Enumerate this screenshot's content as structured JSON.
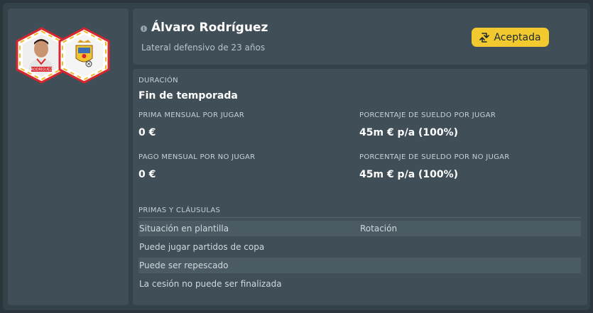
{
  "player": {
    "name": "Álvaro Rodríguez",
    "description": "Lateral defensivo de 23 años",
    "shirt_name": "RODRÍGUEZ"
  },
  "status": {
    "label": "Aceptada",
    "icon": "loan-arrows-icon"
  },
  "duration": {
    "label": "DURACIÓN",
    "value": "Fin de temporada"
  },
  "terms": {
    "monthly_play_label": "PRIMA MENSUAL POR JUGAR",
    "monthly_play_value": "0 €",
    "wage_play_label": "PORCENTAJE DE SUELDO POR JUGAR",
    "wage_play_value": "45m € p/a (100%)",
    "monthly_noplay_label": "PAGO MENSUAL POR NO JUGAR",
    "monthly_noplay_value": "0 €",
    "wage_noplay_label": "PORCENTAJE DE SUELDO POR NO JUGAR",
    "wage_noplay_value": "45m € p/a (100%)"
  },
  "clauses": {
    "header": "PRIMAS Y CLÁUSULAS",
    "rows": [
      {
        "label": "Situación en plantilla",
        "value": "Rotación"
      },
      {
        "label": "Puede jugar partidos de copa",
        "value": ""
      },
      {
        "label": "Puede ser repescado",
        "value": ""
      },
      {
        "label": "La cesión no puede ser finalizada",
        "value": ""
      }
    ]
  },
  "colors": {
    "accent": "#f2ca2f",
    "panel": "#3f4e57",
    "badge_red": "#d7262d"
  }
}
